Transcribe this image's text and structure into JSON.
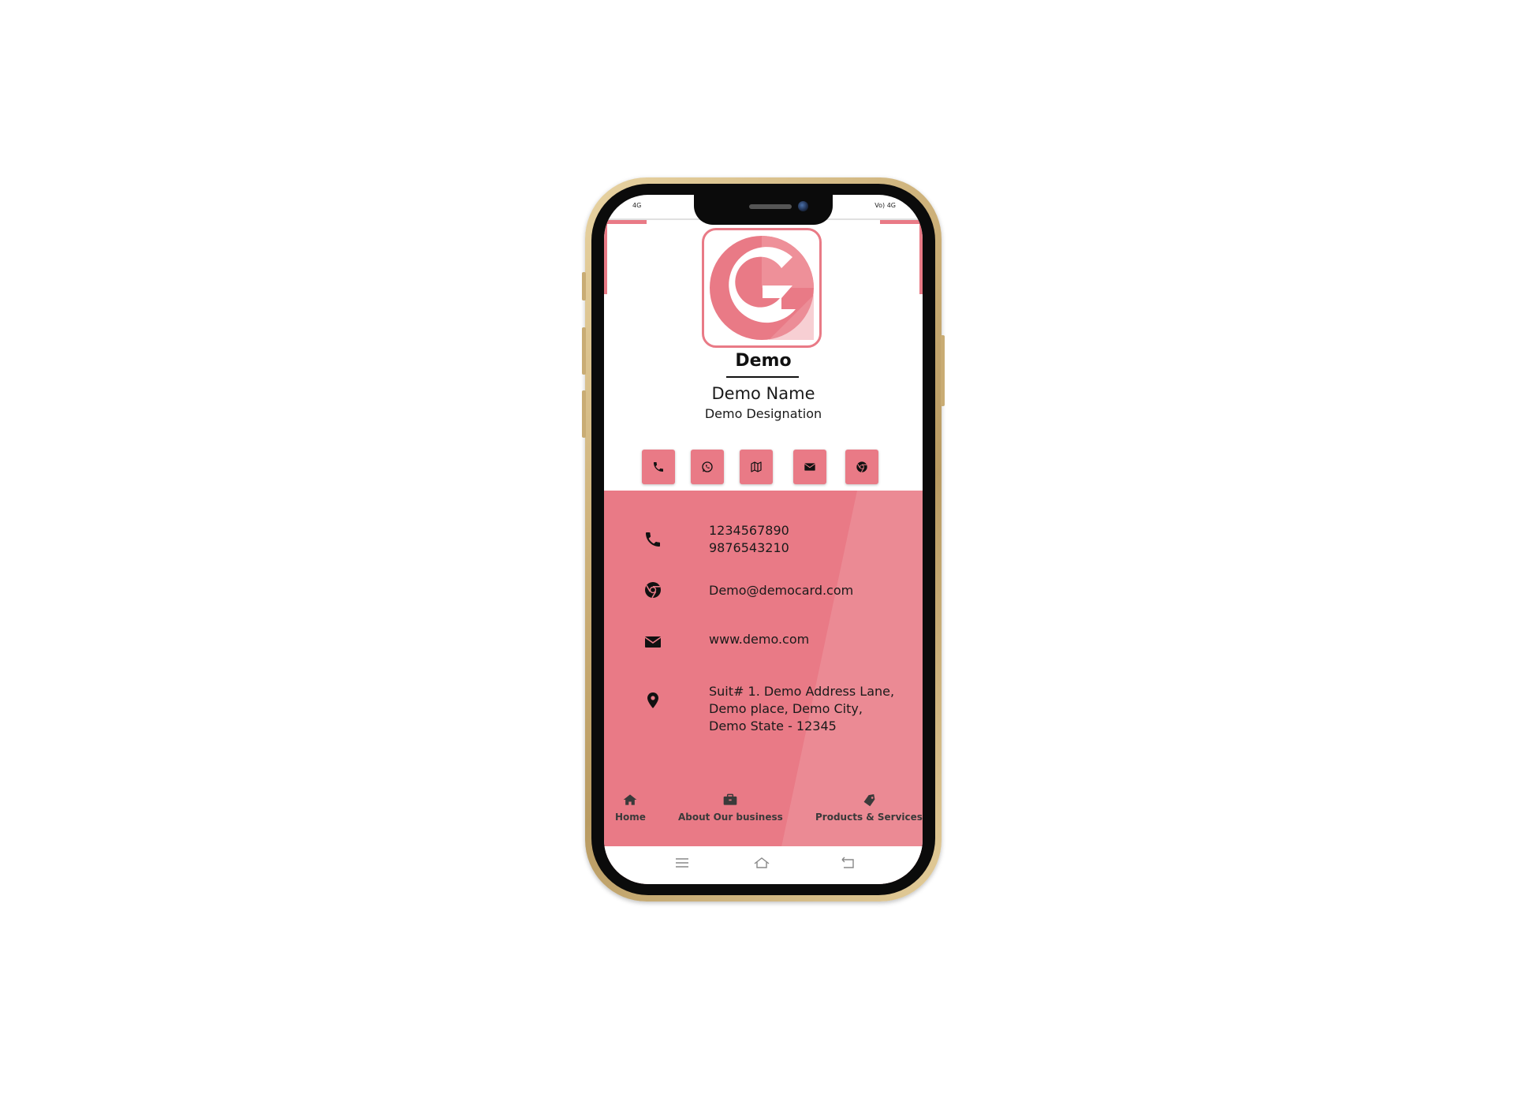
{
  "status_bar": {
    "left": "4G",
    "right": "Vo) 4G"
  },
  "brand": {
    "title": "Demo",
    "accent_color": "#e97a86",
    "logo_icon": "g-logo-icon"
  },
  "person": {
    "name": "Demo Name",
    "designation": "Demo Designation"
  },
  "quick_actions": [
    {
      "icon": "phone-icon"
    },
    {
      "icon": "whatsapp-icon"
    },
    {
      "icon": "map-icon"
    },
    {
      "icon": "envelope-icon"
    },
    {
      "icon": "chrome-icon"
    }
  ],
  "contact": {
    "phone_1": "1234567890",
    "phone_2": "9876543210",
    "email": "Demo@democard.com",
    "website": "www.demo.com",
    "address_line_1": "Suit# 1. Demo Address Lane,",
    "address_line_2": "Demo place, Demo City,",
    "address_line_3": "Demo State - 12345"
  },
  "bottom_nav": {
    "home": "Home",
    "about": "About Our business",
    "products": "Products & Services"
  },
  "system_nav": {
    "menu_icon": "menu-icon",
    "home_icon": "home-outline-icon",
    "back_icon": "back-icon"
  }
}
